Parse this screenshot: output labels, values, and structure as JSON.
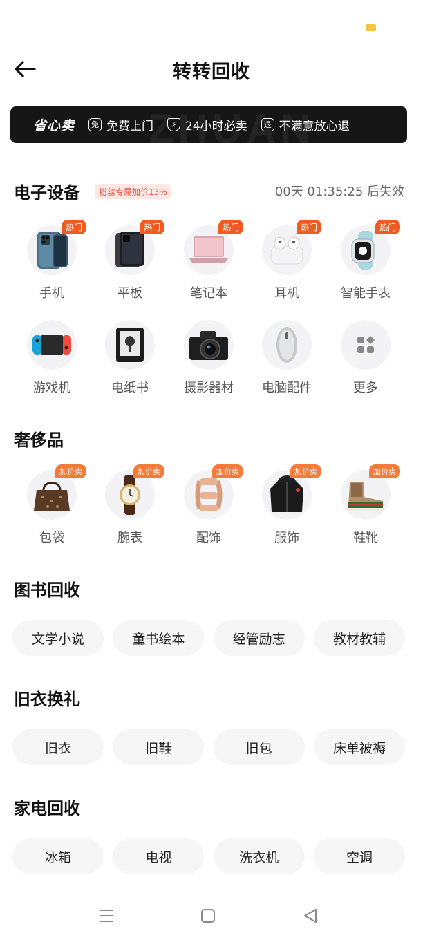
{
  "header": {
    "title": "转转回收"
  },
  "banner": {
    "brand": "省心卖",
    "watermark": "ZHUAN",
    "features": [
      {
        "icon": "免",
        "label": "免费上门"
      },
      {
        "icon": "⚡",
        "label": "24小时必卖"
      },
      {
        "icon": "退",
        "label": "不满意放心退"
      }
    ]
  },
  "electronics": {
    "title": "电子设备",
    "promo": "粉丝专属加价13%",
    "countdown": "00天 01:35:25 后失效",
    "items": [
      {
        "label": "手机",
        "badge": "热门",
        "icon": "phone-icon"
      },
      {
        "label": "平板",
        "badge": "热门",
        "icon": "tablet-icon"
      },
      {
        "label": "笔记本",
        "badge": "热门",
        "icon": "laptop-icon"
      },
      {
        "label": "耳机",
        "badge": "热门",
        "icon": "earbuds-icon"
      },
      {
        "label": "智能手表",
        "badge": "热门",
        "icon": "smartwatch-icon"
      },
      {
        "label": "游戏机",
        "icon": "game-console-icon"
      },
      {
        "label": "电纸书",
        "icon": "ereader-icon"
      },
      {
        "label": "摄影器材",
        "icon": "camera-icon"
      },
      {
        "label": "电脑配件",
        "icon": "mouse-icon"
      },
      {
        "label": "更多",
        "icon": "more-icon"
      }
    ]
  },
  "luxury": {
    "title": "奢侈品",
    "items": [
      {
        "label": "包袋",
        "badge": "加价卖",
        "icon": "handbag-icon"
      },
      {
        "label": "腕表",
        "badge": "加价卖",
        "icon": "wristwatch-icon"
      },
      {
        "label": "配饰",
        "badge": "加价卖",
        "icon": "bracelet-icon"
      },
      {
        "label": "服饰",
        "badge": "加价卖",
        "icon": "jacket-icon"
      },
      {
        "label": "鞋靴",
        "badge": "加价卖",
        "icon": "sneaker-icon"
      }
    ]
  },
  "books": {
    "title": "图书回收",
    "chips": [
      "文学小说",
      "童书绘本",
      "经管励志",
      "教材教辅"
    ]
  },
  "clothes": {
    "title": "旧衣换礼",
    "chips": [
      "旧衣",
      "旧鞋",
      "旧包",
      "床单被褥"
    ]
  },
  "appliances": {
    "title": "家电回收",
    "chips": [
      "冰箱",
      "电视",
      "洗衣机",
      "空调"
    ]
  },
  "colors": {
    "badge_hot": "#f25a1f",
    "badge_price": "#f47c38",
    "promo_text": "#ef4d3c",
    "banner_bg": "#161616"
  }
}
